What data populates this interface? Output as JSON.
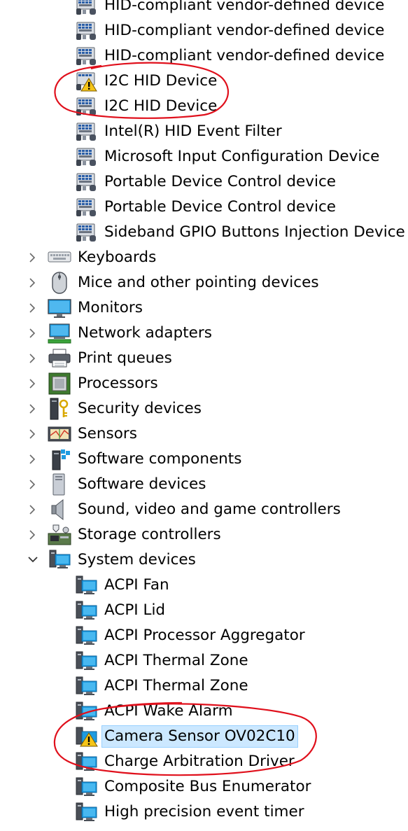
{
  "tree": [
    {
      "kind": "dev",
      "icon": "hid-device-icon",
      "label": "HID-compliant vendor-defined device"
    },
    {
      "kind": "dev",
      "icon": "hid-device-icon",
      "label": "HID-compliant vendor-defined device"
    },
    {
      "kind": "dev",
      "icon": "hid-device-icon",
      "label": "HID-compliant vendor-defined device"
    },
    {
      "kind": "dev",
      "icon": "hid-device-warning-icon",
      "label": "I2C HID Device"
    },
    {
      "kind": "dev",
      "icon": "hid-device-icon",
      "label": "I2C HID Device"
    },
    {
      "kind": "dev",
      "icon": "hid-device-icon",
      "label": "Intel(R) HID Event Filter"
    },
    {
      "kind": "dev",
      "icon": "hid-device-icon",
      "label": "Microsoft Input Configuration Device"
    },
    {
      "kind": "dev",
      "icon": "hid-device-icon",
      "label": "Portable Device Control device"
    },
    {
      "kind": "dev",
      "icon": "hid-device-icon",
      "label": "Portable Device Control device"
    },
    {
      "kind": "dev",
      "icon": "hid-device-icon",
      "label": "Sideband GPIO Buttons Injection Device"
    },
    {
      "kind": "cat",
      "expanded": false,
      "icon": "keyboard-icon",
      "label": "Keyboards"
    },
    {
      "kind": "cat",
      "expanded": false,
      "icon": "mouse-icon",
      "label": "Mice and other pointing devices"
    },
    {
      "kind": "cat",
      "expanded": false,
      "icon": "monitor-icon",
      "label": "Monitors"
    },
    {
      "kind": "cat",
      "expanded": false,
      "icon": "network-adapter-icon",
      "label": "Network adapters"
    },
    {
      "kind": "cat",
      "expanded": false,
      "icon": "printer-icon",
      "label": "Print queues"
    },
    {
      "kind": "cat",
      "expanded": false,
      "icon": "processor-icon",
      "label": "Processors"
    },
    {
      "kind": "cat",
      "expanded": false,
      "icon": "security-device-icon",
      "label": "Security devices"
    },
    {
      "kind": "cat",
      "expanded": false,
      "icon": "sensor-icon",
      "label": "Sensors"
    },
    {
      "kind": "cat",
      "expanded": false,
      "icon": "software-component-icon",
      "label": "Software components"
    },
    {
      "kind": "cat",
      "expanded": false,
      "icon": "software-device-icon",
      "label": "Software devices"
    },
    {
      "kind": "cat",
      "expanded": false,
      "icon": "speaker-icon",
      "label": "Sound, video and game controllers"
    },
    {
      "kind": "cat",
      "expanded": false,
      "icon": "storage-controller-icon",
      "label": "Storage controllers"
    },
    {
      "kind": "cat",
      "expanded": true,
      "icon": "system-device-icon",
      "label": "System devices"
    },
    {
      "kind": "dev",
      "icon": "system-device-icon",
      "label": "ACPI Fan"
    },
    {
      "kind": "dev",
      "icon": "system-device-icon",
      "label": "ACPI Lid"
    },
    {
      "kind": "dev",
      "icon": "system-device-icon",
      "label": "ACPI Processor Aggregator"
    },
    {
      "kind": "dev",
      "icon": "system-device-icon",
      "label": "ACPI Thermal Zone"
    },
    {
      "kind": "dev",
      "icon": "system-device-icon",
      "label": "ACPI Thermal Zone"
    },
    {
      "kind": "dev",
      "icon": "system-device-icon",
      "label": "ACPI Wake Alarm"
    },
    {
      "kind": "dev",
      "icon": "system-device-warning-icon",
      "label": "Camera Sensor OV02C10",
      "selected": true
    },
    {
      "kind": "dev",
      "icon": "system-device-icon",
      "label": "Charge Arbitration Driver"
    },
    {
      "kind": "dev",
      "icon": "system-device-icon",
      "label": "Composite Bus Enumerator"
    },
    {
      "kind": "dev",
      "icon": "system-device-icon",
      "label": "High precision event timer"
    }
  ],
  "annotations": {
    "color": "#e0101c"
  }
}
